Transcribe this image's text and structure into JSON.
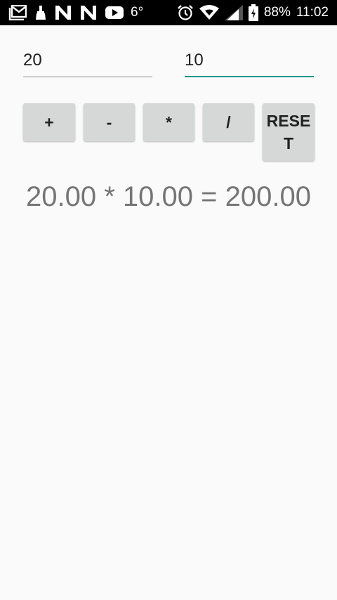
{
  "status_bar": {
    "temperature": "6°",
    "battery": "88%",
    "time": "11:02",
    "left_icons": [
      "gmail-icon",
      "cleaner-icon",
      "n-icon",
      "n-icon",
      "youtube-icon"
    ],
    "right_icons": [
      "alarm-icon",
      "wifi-icon",
      "signal-icon",
      "battery-charging-icon"
    ]
  },
  "inputs": {
    "first_value": "20",
    "second_value": "10"
  },
  "buttons": {
    "add": "+",
    "subtract": "-",
    "multiply": "*",
    "divide": "/",
    "reset": "RESET"
  },
  "result": "20.00 * 10.00 = 200.00",
  "colors": {
    "accent": "#009688",
    "button_bg": "#d6d7d7",
    "result_text": "#757575",
    "background": "#fafafa"
  }
}
